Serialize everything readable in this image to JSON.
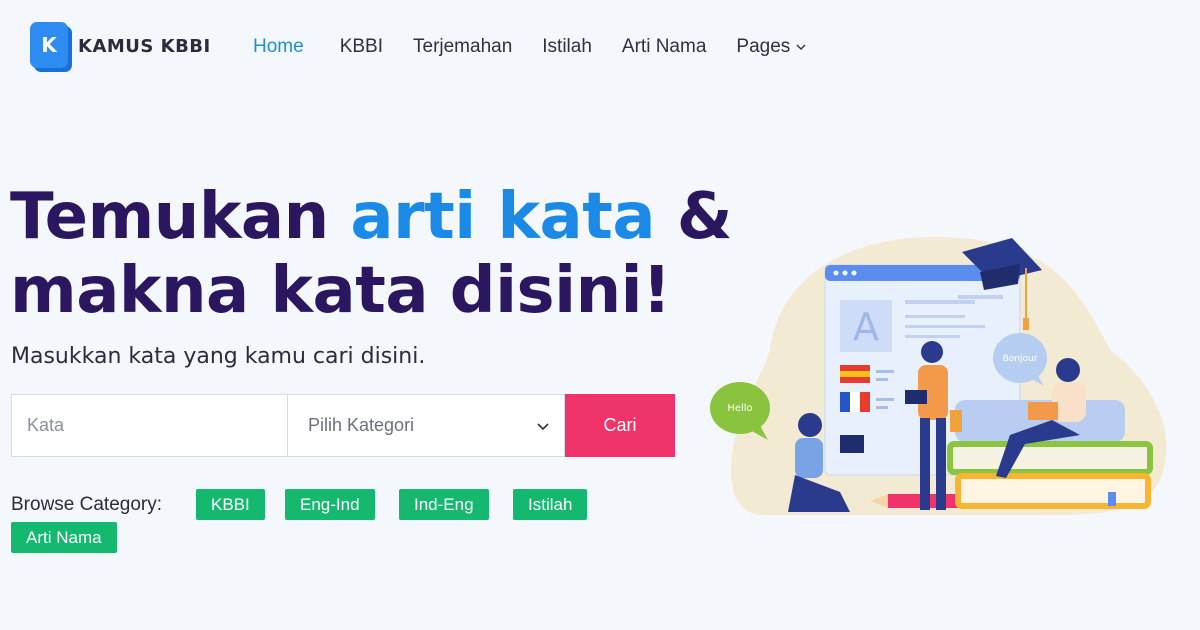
{
  "header": {
    "logo_letter": "K",
    "brand": "KAMUS KBBI",
    "nav": [
      {
        "label": "Home",
        "active": true
      },
      {
        "label": "KBBI"
      },
      {
        "label": "Terjemahan"
      },
      {
        "label": "Istilah"
      },
      {
        "label": "Arti Nama"
      },
      {
        "label": "Pages",
        "dropdown": true
      }
    ]
  },
  "hero": {
    "title_part1": "Temukan ",
    "title_highlight": "arti kata",
    "title_part2": " &",
    "title_line2": "makna kata disini!",
    "subtitle": "Masukkan kata yang kamu cari disini."
  },
  "search": {
    "placeholder": "Kata",
    "category_selected": "Pilih Kategori",
    "button": "Cari"
  },
  "categories": {
    "label": "Browse Category:",
    "items": [
      "KBBI",
      "Eng-Ind",
      "Ind-Eng",
      "Istilah",
      "Arti Nama"
    ]
  },
  "illustration": {
    "bubble_left": "Hello",
    "bubble_right": "Bonjour",
    "board_letter": "A"
  },
  "colors": {
    "accent": "#1a8ae6",
    "title": "#2a1760",
    "button": "#f0336b",
    "tag": "#14b86f"
  }
}
